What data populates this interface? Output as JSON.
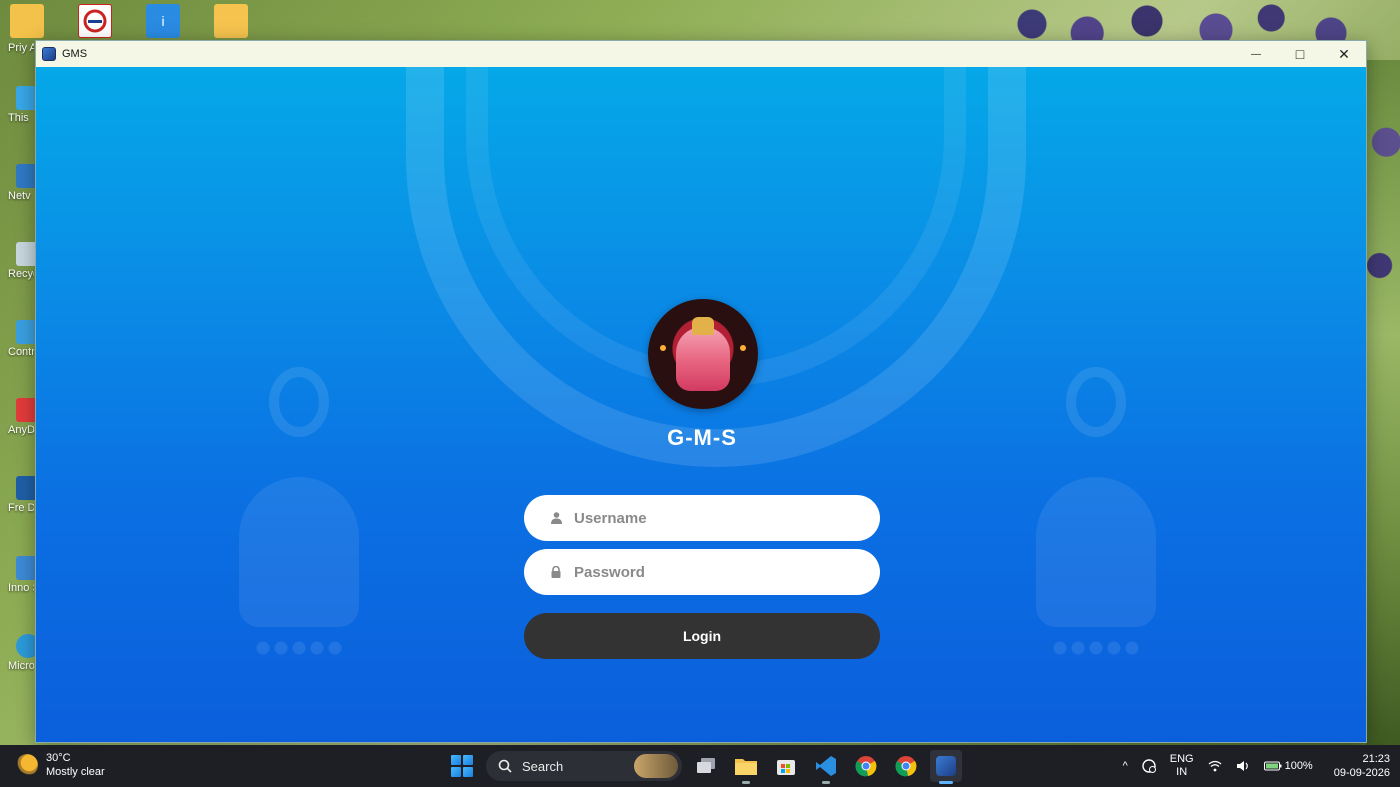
{
  "desktop": {
    "icons": [
      {
        "label": "Priy Aga"
      },
      {
        "label": "This"
      },
      {
        "label": "Netv"
      },
      {
        "label": "Recyc"
      },
      {
        "label": "Contro"
      },
      {
        "label": "AnyD"
      },
      {
        "label": "Fre Dowr"
      },
      {
        "label": "Inno S Com"
      },
      {
        "label": "Micro Ed"
      }
    ]
  },
  "window": {
    "title": "GMS",
    "minimize": "—",
    "maximize": "□",
    "close": "✕"
  },
  "login": {
    "app_name": "G-M-S",
    "username_placeholder": "Username",
    "password_placeholder": "Password",
    "login_label": "Login"
  },
  "taskbar": {
    "weather_temp": "30°C",
    "weather_desc": "Mostly clear",
    "search_label": "Search",
    "tray_up": "^",
    "lang_top": "ENG",
    "lang_bottom": "IN",
    "battery": "100%",
    "time": "21:23",
    "date": "09-09-2026"
  }
}
